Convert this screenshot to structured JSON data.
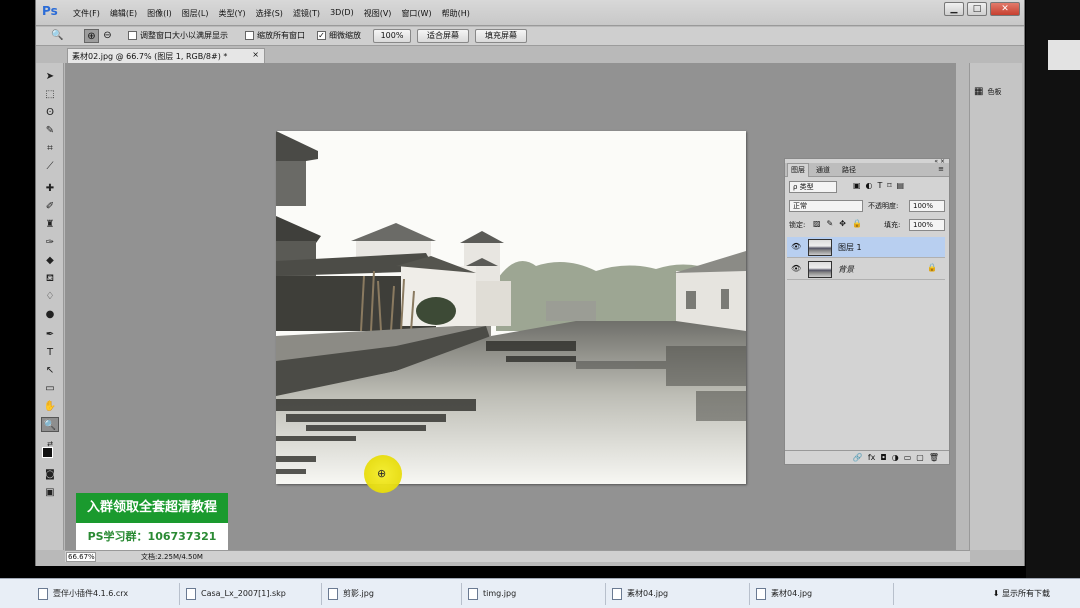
{
  "app": {
    "logo": "Ps",
    "menu": [
      "文件(F)",
      "编辑(E)",
      "图像(I)",
      "图层(L)",
      "类型(Y)",
      "选择(S)",
      "滤镜(T)",
      "3D(D)",
      "视图(V)",
      "窗口(W)",
      "帮助(H)"
    ],
    "window_buttons": [
      "▁",
      "□",
      "✕"
    ]
  },
  "options": {
    "resize_window": "调整窗口大小以满屏显示",
    "zoom_all": "缩放所有窗口",
    "scrubby_zoom": "细微缩放",
    "scrubby_checked": true,
    "zoom_value": "100%",
    "fit_screen": "适合屏幕",
    "fill_screen": "填充屏幕"
  },
  "document": {
    "tab_title": "素材02.jpg @ 66.7% (图层 1, RGB/8#) *",
    "close": "×"
  },
  "layers_panel": {
    "tabs": [
      "图层",
      "通道",
      "路径"
    ],
    "filter_kind": "ρ 类型",
    "blend_mode": "正常",
    "opacity_label": "不透明度:",
    "opacity_value": "100%",
    "lock_label": "锁定:",
    "fill_label": "填充:",
    "fill_value": "100%",
    "layers": [
      {
        "name": "图层 1",
        "selected": true
      },
      {
        "name": "背景",
        "locked": true
      }
    ],
    "footer_icons": [
      "🔗",
      "fx",
      "◘",
      "◑",
      "▭",
      "▢",
      "🗑"
    ]
  },
  "right_dock": {
    "swatches_label": "色板"
  },
  "status": {
    "zoom": "66.67%",
    "doc_info": "文档:2.25M/4.50M"
  },
  "promo": {
    "line1": "入群领取全套超清教程",
    "line2": "PS学习群：106737321"
  },
  "taskbar": {
    "items": [
      "壹伴小插件4.1.6.crx",
      "Casa_Lx_2007[1].skp",
      "剪影.jpg",
      "timg.jpg",
      "素材04.jpg",
      "素材04.jpg"
    ],
    "downloads": "显示所有下载"
  }
}
